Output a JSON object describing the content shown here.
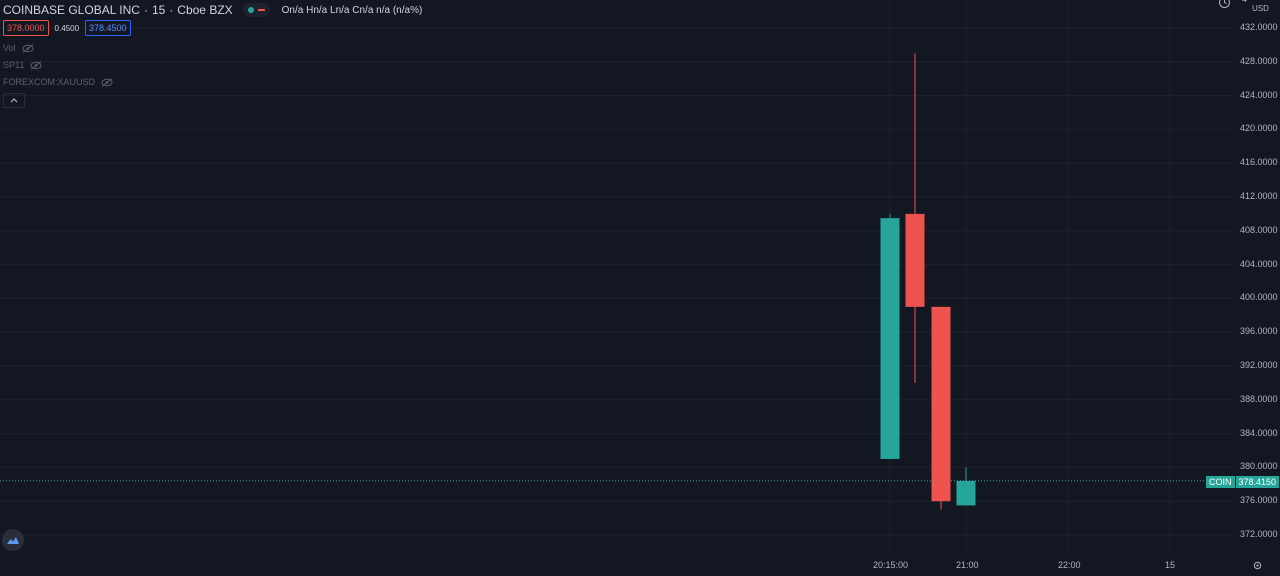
{
  "legend": {
    "symbol": "COINBASE GLOBAL INC",
    "interval": "15",
    "exchange": "Cboe BZX",
    "ohlc_text": "On/a Hn/a Ln/a Cn/a n/a (n/a%)",
    "bid": "378.0000",
    "spread": "0.4500",
    "ask": "378.4500"
  },
  "indicators": [
    {
      "label": "Vol"
    },
    {
      "label": "SP11"
    },
    {
      "label": "FOREXCOM:XAUUSD"
    }
  ],
  "price_scale": {
    "currency": "USD",
    "top_partial": "4",
    "ticks": [
      "432.0000",
      "428.0000",
      "424.0000",
      "420.0000",
      "416.0000",
      "412.0000",
      "408.0000",
      "404.0000",
      "400.0000",
      "396.0000",
      "392.0000",
      "388.0000",
      "384.0000",
      "380.0000",
      "376.0000",
      "372.0000"
    ],
    "tick_values": [
      432,
      428,
      424,
      420,
      416,
      412,
      408,
      404,
      400,
      396,
      392,
      388,
      384,
      380,
      376,
      372
    ],
    "last_price_symbol": "COIN",
    "last_price_value": "378.4150",
    "last_price": 378.415
  },
  "time_scale": {
    "ticks": [
      "20:15:00",
      "21:00",
      "22:00",
      "15"
    ]
  },
  "colors": {
    "up": "#26a69a",
    "down": "#ef5350",
    "background": "#131722",
    "grid": "#1e222d"
  },
  "chart_data": {
    "type": "candlestick",
    "series": [
      {
        "open": 381.0,
        "high": 410.0,
        "low": 381.0,
        "close": 409.5,
        "direction": "up"
      },
      {
        "open": 410.0,
        "high": 429.0,
        "low": 390.0,
        "close": 399.0,
        "direction": "down"
      },
      {
        "open": 399.0,
        "high": 399.0,
        "low": 375.0,
        "close": 376.0,
        "direction": "down"
      },
      {
        "open": 375.5,
        "high": 380.0,
        "low": 375.5,
        "close": 378.4,
        "direction": "up"
      }
    ],
    "ylim": [
      370,
      433
    ]
  }
}
